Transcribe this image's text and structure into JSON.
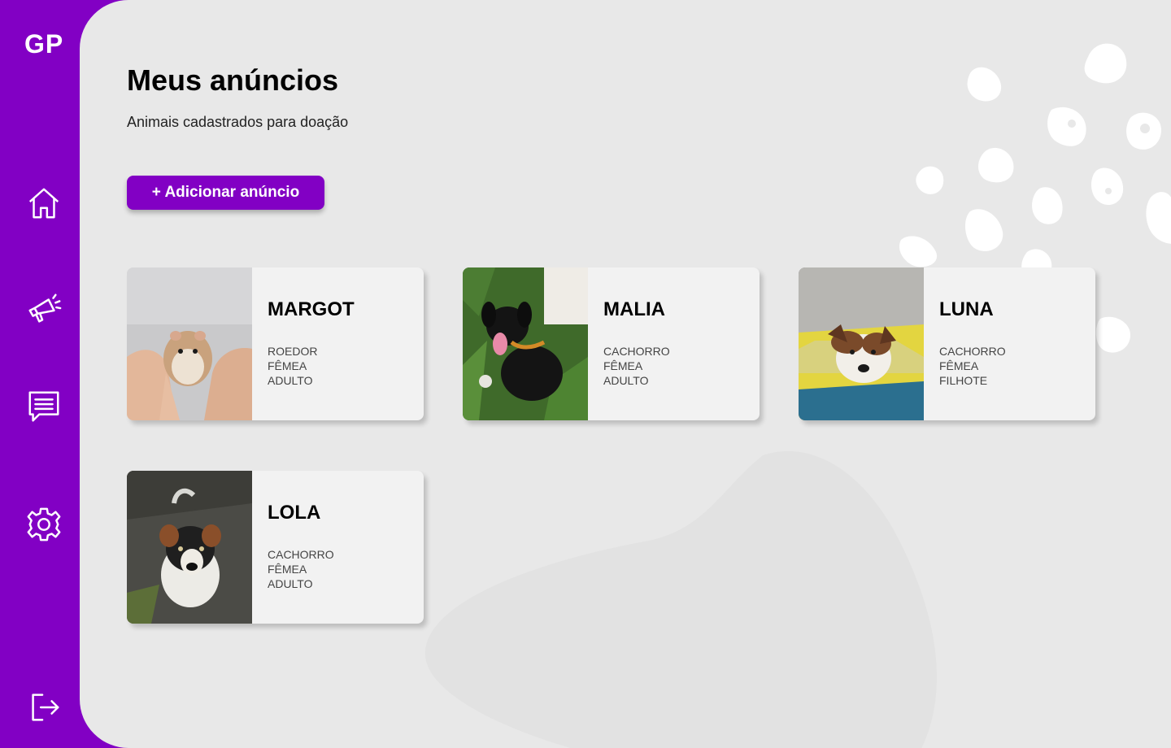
{
  "app": {
    "logo": "GP"
  },
  "page": {
    "title": "Meus anúncios",
    "subtitle": "Animais cadastrados para doação",
    "add_button_label": "+ Adicionar anúncio"
  },
  "nav": [
    {
      "icon": "home-icon"
    },
    {
      "icon": "megaphone-icon"
    },
    {
      "icon": "chat-icon"
    },
    {
      "icon": "gear-icon"
    },
    {
      "icon": "logout-icon"
    }
  ],
  "cards": [
    {
      "name": "MARGOT",
      "species": "ROEDOR",
      "sex": "FÊMEA",
      "age": "ADULTO"
    },
    {
      "name": "MALIA",
      "species": "CACHORRO",
      "sex": "FÊMEA",
      "age": "ADULTO"
    },
    {
      "name": "LUNA",
      "species": "CACHORRO",
      "sex": "FÊMEA",
      "age": "FILHOTE"
    },
    {
      "name": "LOLA",
      "species": "CACHORRO",
      "sex": "FÊMEA",
      "age": "ADULTO"
    }
  ],
  "colors": {
    "brand": "#8200c4",
    "background": "#e8e8e8",
    "card": "#f2f2f2"
  }
}
